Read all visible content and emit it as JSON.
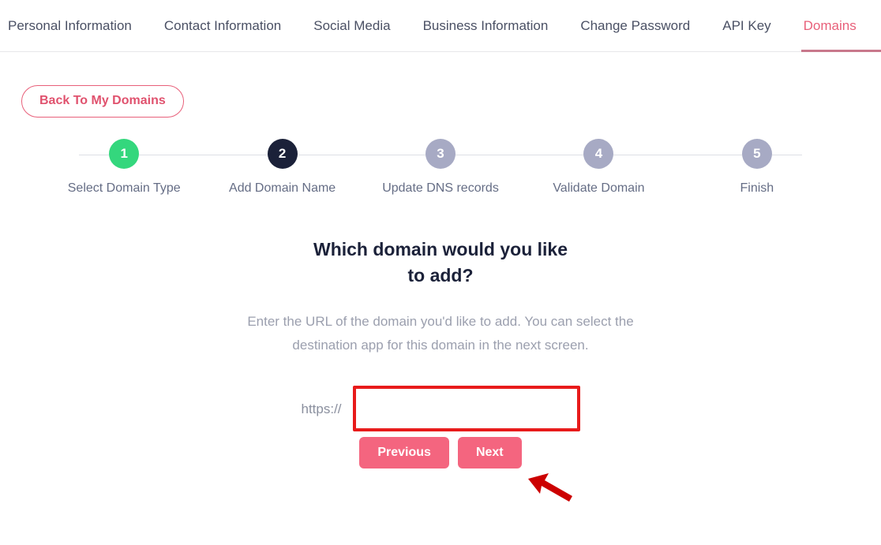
{
  "tabs": [
    {
      "label": "Personal Information",
      "active": false
    },
    {
      "label": "Contact Information",
      "active": false
    },
    {
      "label": "Social Media",
      "active": false
    },
    {
      "label": "Business Information",
      "active": false
    },
    {
      "label": "Change Password",
      "active": false
    },
    {
      "label": "API Key",
      "active": false
    },
    {
      "label": "Domains",
      "active": true
    }
  ],
  "back_button": {
    "label": "Back To My Domains"
  },
  "stepper": {
    "steps": [
      {
        "number": "1",
        "label": "Select Domain Type",
        "state": "done"
      },
      {
        "number": "2",
        "label": "Add Domain Name",
        "state": "active"
      },
      {
        "number": "3",
        "label": "Update DNS records",
        "state": "pending"
      },
      {
        "number": "4",
        "label": "Validate Domain",
        "state": "pending"
      },
      {
        "number": "5",
        "label": "Finish",
        "state": "pending"
      }
    ]
  },
  "panel": {
    "heading": "Which domain would you like to add?",
    "description": "Enter the URL of the domain you'd like to add. You can select the destination app for this domain in the next screen.",
    "protocol_label": "https://",
    "url_input": {
      "value": "",
      "placeholder": ""
    },
    "previous_label": "Previous",
    "next_label": "Next"
  },
  "colors": {
    "accent_pink": "#f4657f",
    "tab_active": "#e8607a",
    "step_done": "#34d77d",
    "step_active": "#1b2139",
    "step_pending": "#a7aac4",
    "annotation_red": "#e81b1b"
  }
}
